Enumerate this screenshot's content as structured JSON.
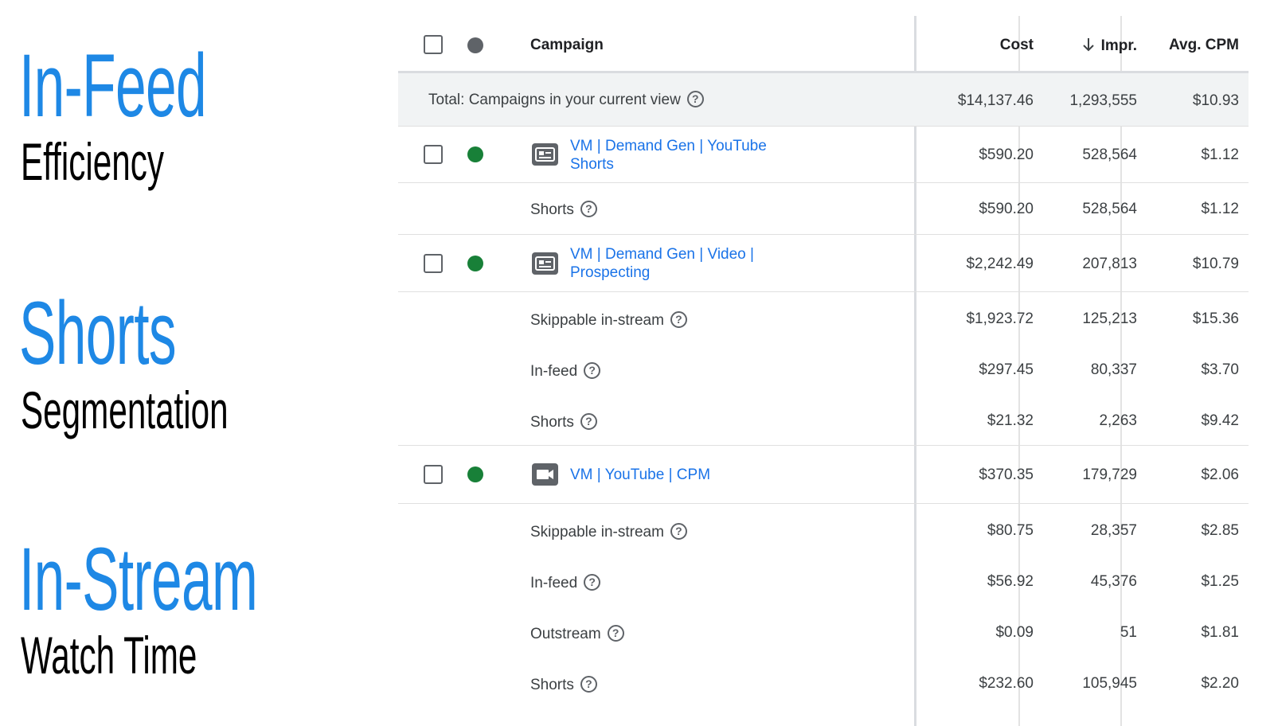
{
  "headlines": [
    {
      "title": "In-Feed",
      "subtitle": "Efficiency"
    },
    {
      "title": "Shorts",
      "subtitle": "Segmentation"
    },
    {
      "title": "In-Stream",
      "subtitle": "Watch Time"
    }
  ],
  "table": {
    "columns": {
      "campaign": "Campaign",
      "cost": "Cost",
      "impr": "Impr.",
      "avg_cpm": "Avg. CPM"
    },
    "sort": {
      "column": "Impr.",
      "direction": "descending",
      "icon": "arrow-down-icon"
    },
    "total": {
      "label": "Total: Campaigns in your current view",
      "cost": "$14,137.46",
      "impr": "1,293,555",
      "avg_cpm": "$10.93"
    },
    "campaigns": [
      {
        "name_line1": "VM | Demand Gen | YouTube",
        "name_line2": "Shorts",
        "status_color": "#188038",
        "type_icon": "demand-gen-icon",
        "cost": "$590.20",
        "impr": "528,564",
        "avg_cpm": "$1.12",
        "segments": [
          {
            "label": "Shorts",
            "cost": "$590.20",
            "impr": "528,564",
            "avg_cpm": "$1.12"
          }
        ]
      },
      {
        "name_line1": "VM | Demand Gen | Video |",
        "name_line2": "Prospecting",
        "status_color": "#188038",
        "type_icon": "demand-gen-icon",
        "cost": "$2,242.49",
        "impr": "207,813",
        "avg_cpm": "$10.79",
        "segments": [
          {
            "label": "Skippable in-stream",
            "cost": "$1,923.72",
            "impr": "125,213",
            "avg_cpm": "$15.36"
          },
          {
            "label": "In-feed",
            "cost": "$297.45",
            "impr": "80,337",
            "avg_cpm": "$3.70"
          },
          {
            "label": "Shorts",
            "cost": "$21.32",
            "impr": "2,263",
            "avg_cpm": "$9.42"
          }
        ]
      },
      {
        "name_line1": "VM | YouTube | CPM",
        "name_line2": "",
        "status_color": "#188038",
        "type_icon": "video-camera-icon",
        "cost": "$370.35",
        "impr": "179,729",
        "avg_cpm": "$2.06",
        "segments": [
          {
            "label": "Skippable in-stream",
            "cost": "$80.75",
            "impr": "28,357",
            "avg_cpm": "$2.85"
          },
          {
            "label": "In-feed",
            "cost": "$56.92",
            "impr": "45,376",
            "avg_cpm": "$1.25"
          },
          {
            "label": "Outstream",
            "cost": "$0.09",
            "impr": "51",
            "avg_cpm": "$1.81"
          },
          {
            "label": "Shorts",
            "cost": "$232.60",
            "impr": "105,945",
            "avg_cpm": "$2.20"
          }
        ]
      }
    ],
    "colors": {
      "link": "#1a73e8",
      "headline": "#1e88e5",
      "status_enabled": "#188038",
      "status_header": "#5f6368"
    }
  }
}
